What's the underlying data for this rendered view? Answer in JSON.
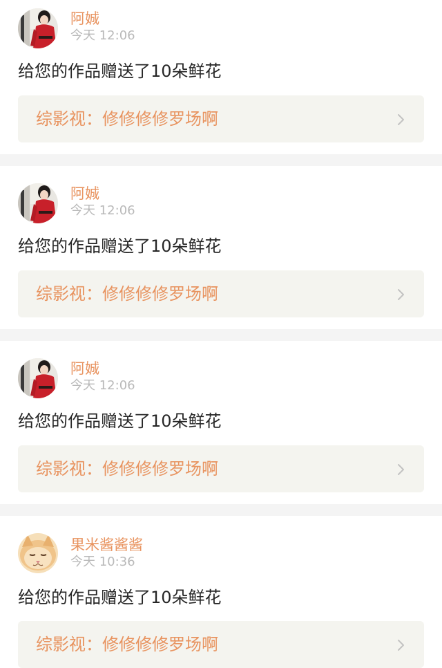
{
  "notifications": [
    {
      "username": "阿娍",
      "timestamp": "今天 12:06",
      "action": "给您的作品赠送了10朵鲜花",
      "work_category": "综影视：",
      "work_title": "修修修修罗场啊",
      "avatar_icon": "girl-in-red-avatar"
    },
    {
      "username": "阿娍",
      "timestamp": "今天 12:06",
      "action": "给您的作品赠送了10朵鲜花",
      "work_category": "综影视：",
      "work_title": "修修修修罗场啊",
      "avatar_icon": "girl-in-red-avatar"
    },
    {
      "username": "阿娍",
      "timestamp": "今天 12:06",
      "action": "给您的作品赠送了10朵鲜花",
      "work_category": "综影视：",
      "work_title": "修修修修罗场啊",
      "avatar_icon": "girl-in-red-avatar"
    },
    {
      "username": "果米酱酱酱",
      "timestamp": "今天 10:36",
      "action": "给您的作品赠送了10朵鲜花",
      "work_category": "综影视：",
      "work_title": "修修修修罗场啊",
      "avatar_icon": "kitten-avatar"
    }
  ],
  "colors": {
    "accent": "#e8935f",
    "timestamp": "#b9b9b9",
    "body_text": "#262626",
    "link_background": "#f4f4ef",
    "page_background": "#f4f4f4",
    "chevron": "#c2c2c2"
  },
  "icons": {
    "chevron": "chevron-right-icon"
  }
}
